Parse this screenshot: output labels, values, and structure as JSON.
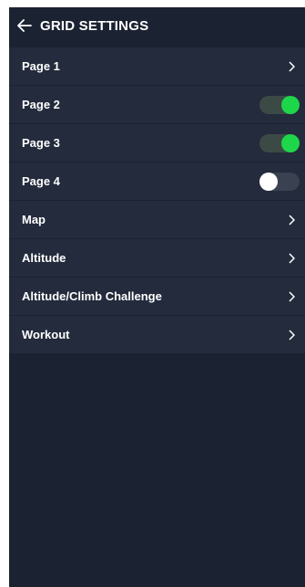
{
  "header": {
    "title": "GRID SETTINGS",
    "back_icon": "arrow-left-icon"
  },
  "colors": {
    "background": "#1b2232",
    "row_background": "#232b3c",
    "toggle_on": "#1ed64a",
    "toggle_off_knob": "#ffffff",
    "text": "#ffffff"
  },
  "rows": [
    {
      "label": "Page 1",
      "control": "chevron"
    },
    {
      "label": "Page 2",
      "control": "toggle",
      "on": true
    },
    {
      "label": "Page 3",
      "control": "toggle",
      "on": true
    },
    {
      "label": "Page 4",
      "control": "toggle",
      "on": false
    },
    {
      "label": "Map",
      "control": "chevron"
    },
    {
      "label": "Altitude",
      "control": "chevron"
    },
    {
      "label": "Altitude/Climb Challenge",
      "control": "chevron"
    },
    {
      "label": "Workout",
      "control": "chevron"
    }
  ]
}
